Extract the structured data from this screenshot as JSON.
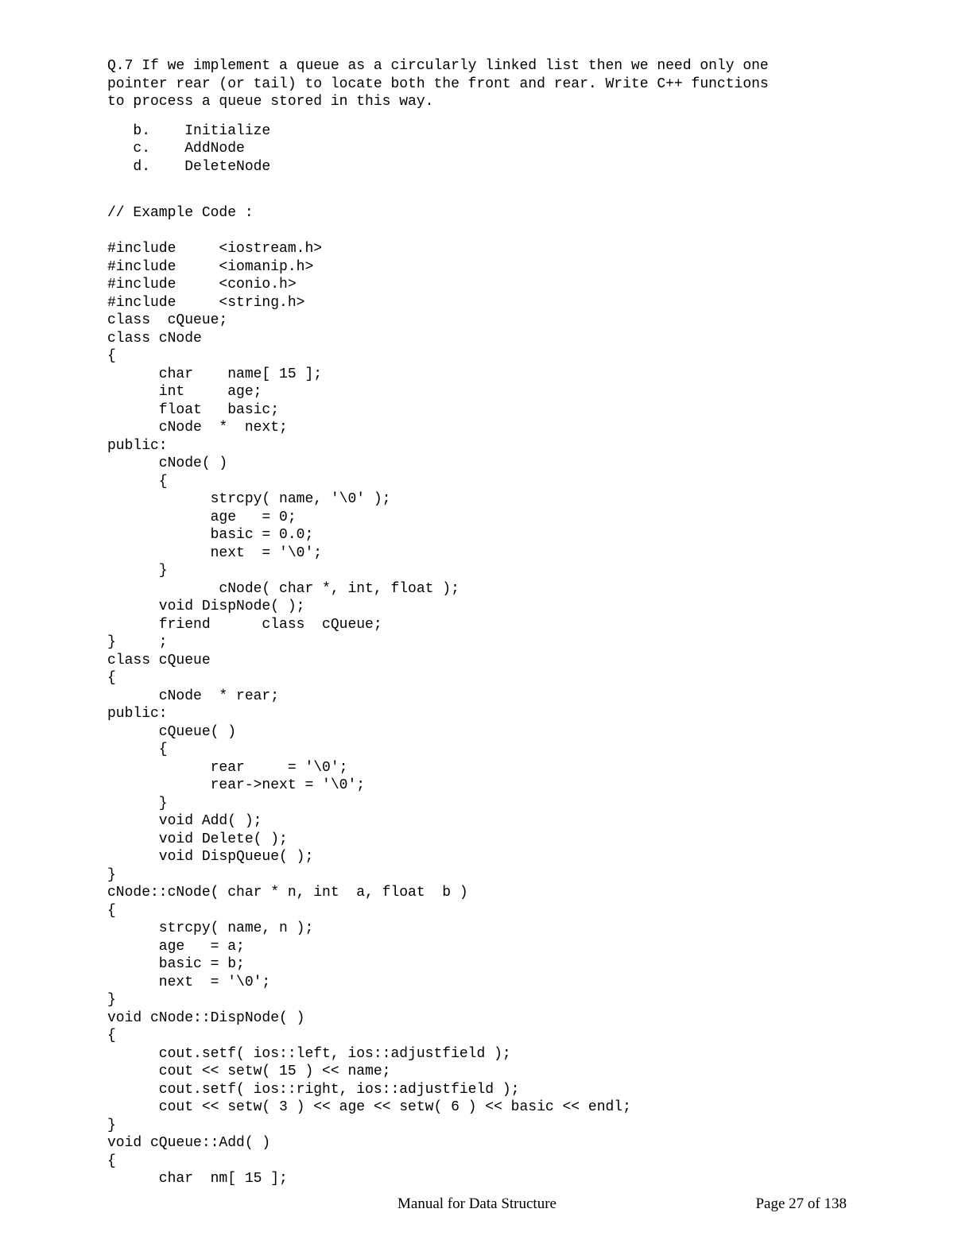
{
  "question": "Q.7 If we implement a queue as a circularly linked list then we need only one\npointer rear (or tail) to locate both the front and rear. Write C++ functions\nto process a queue stored in this way.",
  "options": "   b.    Initialize\n   c.    AddNode\n   d.    DeleteNode",
  "code": "// Example Code :\n\n#include     <iostream.h>\n#include     <iomanip.h>\n#include     <conio.h>\n#include     <string.h>\nclass  cQueue;\nclass cNode\n{\n      char    name[ 15 ];\n      int     age;\n      float   basic;\n      cNode  *  next;\npublic:\n      cNode( )\n      {\n            strcpy( name, '\\0' );\n            age   = 0;\n            basic = 0.0;\n            next  = '\\0';\n      }\n             cNode( char *, int, float );\n      void DispNode( );\n      friend      class  cQueue;\n}     ;\nclass cQueue\n{\n      cNode  * rear;\npublic:\n      cQueue( )\n      {\n            rear     = '\\0';\n            rear->next = '\\0';\n      }\n      void Add( );\n      void Delete( );\n      void DispQueue( );\n}\ncNode::cNode( char * n, int  a, float  b )\n{\n      strcpy( name, n );\n      age   = a;\n      basic = b;\n      next  = '\\0';\n}\nvoid cNode::DispNode( )\n{\n      cout.setf( ios::left, ios::adjustfield );\n      cout << setw( 15 ) << name;\n      cout.setf( ios::right, ios::adjustfield );\n      cout << setw( 3 ) << age << setw( 6 ) << basic << endl;\n}\nvoid cQueue::Add( )\n{\n      char  nm[ 15 ];",
  "footer": {
    "center": "Manual for Data Structure",
    "right": "Page 27 of 138"
  }
}
